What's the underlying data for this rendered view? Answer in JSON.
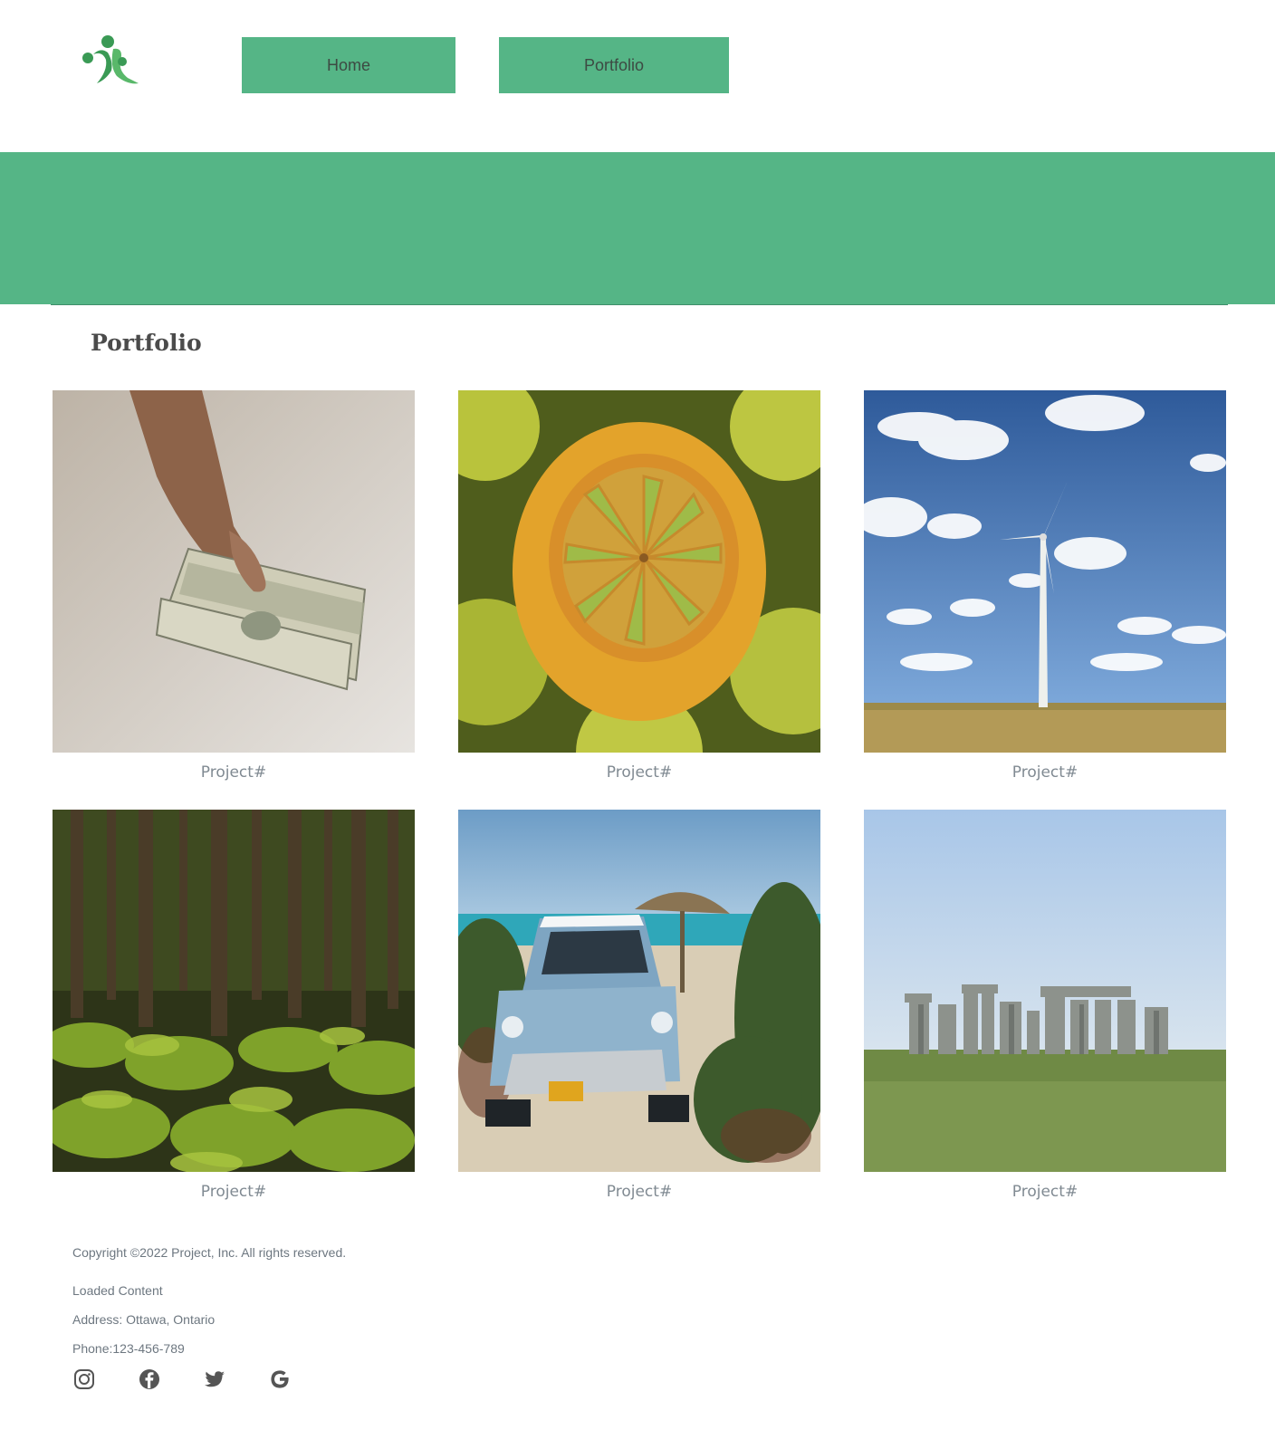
{
  "header": {
    "logo_icon": "green-figures-logo-icon",
    "nav": [
      {
        "label": "Home"
      },
      {
        "label": "Portfolio"
      }
    ]
  },
  "colors": {
    "brand_green": "#55b586",
    "nav_text": "#3d4a43",
    "caption_text": "#808a92",
    "footer_text": "#6d7780"
  },
  "main": {
    "title": "Portfolio",
    "projects": [
      {
        "image": "hand-holding-dollar-bills",
        "caption": "Project#"
      },
      {
        "image": "cut-lemon-citrus-closeup",
        "caption": "Project#"
      },
      {
        "image": "wind-turbine-field-sky",
        "caption": "Project#"
      },
      {
        "image": "mossy-forest",
        "caption": "Project#"
      },
      {
        "image": "vintage-car-on-beach",
        "caption": "Project#"
      },
      {
        "image": "stonehenge",
        "caption": "Project#"
      }
    ]
  },
  "footer": {
    "copyright": "Copyright ©2022 Project, Inc. All rights reserved.",
    "loaded": "Loaded Content",
    "address": "Address: Ottawa, Ontario",
    "phone": "Phone:123-456-789",
    "social_icons": [
      "instagram-icon",
      "facebook-icon",
      "twitter-icon",
      "google-icon"
    ]
  }
}
